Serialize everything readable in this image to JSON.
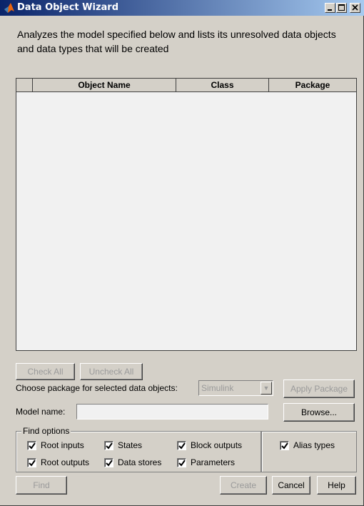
{
  "window": {
    "title": "Data Object Wizard",
    "controls": [
      "_",
      "□",
      "×"
    ]
  },
  "description": "Analyzes the model specified below and lists its unresolved data objects and data types that will be created",
  "table": {
    "columns": [
      "",
      "Object Name",
      "Class",
      "Package"
    ],
    "rows": []
  },
  "buttons": {
    "check_all": "Check All",
    "uncheck_all": "Uncheck All",
    "apply_package": "Apply Package",
    "browse": "Browse...",
    "find": "Find",
    "create": "Create",
    "cancel": "Cancel",
    "help": "Help"
  },
  "package": {
    "label": "Choose package for selected data objects:",
    "selected": "Simulink"
  },
  "model": {
    "label": "Model name:",
    "value": ""
  },
  "find_options": {
    "title": "Find options",
    "root_inputs": "Root inputs",
    "states": "States",
    "block_outputs": "Block outputs",
    "root_outputs": "Root outputs",
    "data_stores": "Data stores",
    "parameters": "Parameters",
    "alias_types": "Alias types"
  },
  "colors": {
    "window_bg": "#d4d0c8",
    "titlebar_start": "#0a246a",
    "titlebar_end": "#a6caf0",
    "disabled_text": "#9a9a9a"
  }
}
